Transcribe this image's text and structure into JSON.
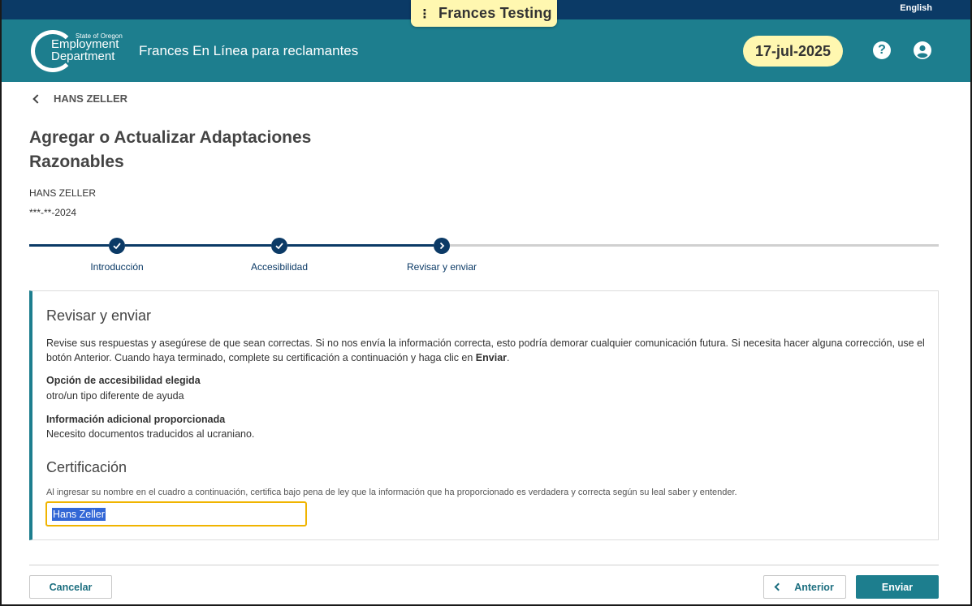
{
  "top_bar": {
    "language_link": "English"
  },
  "testing_badge": {
    "label": "Frances Testing"
  },
  "header": {
    "logo_small": "State of Oregon",
    "logo_line1": "Employment",
    "logo_line2": "Department",
    "app_title": "Frances En Línea para reclamantes",
    "date": "17-jul-2025",
    "help_symbol": "?",
    "icons": [
      "help-icon",
      "account-icon"
    ]
  },
  "breadcrumb": {
    "back_label": "HANS ZELLER"
  },
  "page": {
    "title": "Agregar o Actualizar Adaptaciones Razonables",
    "claimant_name": "HANS ZELLER",
    "claimant_ssn": "***-**-2024"
  },
  "stepper": {
    "steps": [
      {
        "label": "Introducción",
        "status": "complete"
      },
      {
        "label": "Accesibilidad",
        "status": "complete"
      },
      {
        "label": "Revisar y enviar",
        "status": "current"
      }
    ],
    "colors": {
      "active": "#0b3a66",
      "inactive": "#d0d0d0"
    }
  },
  "review": {
    "heading": "Revisar y enviar",
    "intro_text": "Revise sus respuestas y asegúrese de que sean correctas. Si no nos envía la información correcta, esto podría demorar cualquier comunicación futura. Si necesita hacer alguna corrección, use el botón Anterior. Cuando haya terminado, complete su certificación a continuación y haga clic en ",
    "intro_bold": "Enviar",
    "intro_end": ".",
    "accessibility_label": "Opción de accesibilidad elegida",
    "accessibility_value": "otro/un tipo diferente de ayuda",
    "additional_label": "Información adicional proporcionada",
    "additional_value": "Necesito documentos traducidos al ucraniano."
  },
  "certification": {
    "heading": "Certificación",
    "text": "Al ingresar su nombre en el cuadro a continuación, certifica bajo pena de ley que la información que ha proporcionado es verdadera y correcta según su leal saber y entender.",
    "signature_value": "Hans Zeller"
  },
  "actions": {
    "cancel": "Cancelar",
    "previous": "Anterior",
    "submit": "Enviar"
  },
  "colors": {
    "header_teal": "#1d7e8e",
    "navy": "#0b3a66",
    "highlight_yellow": "#fff7b0",
    "focus_border": "#f0b400"
  }
}
